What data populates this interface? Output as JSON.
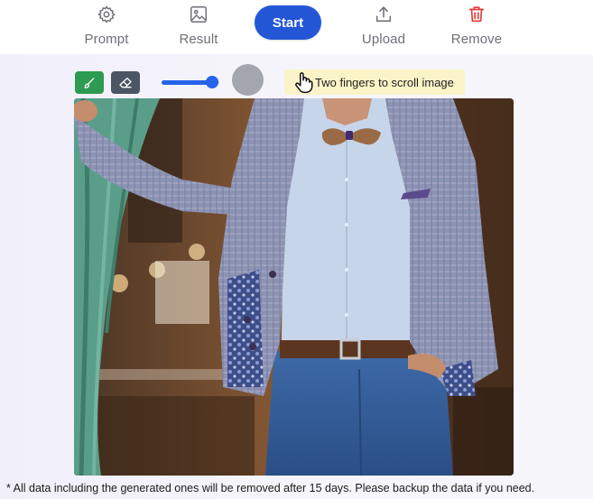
{
  "toolbar": {
    "prompt_label": "Prompt",
    "result_label": "Result",
    "start_label": "Start",
    "upload_label": "Upload",
    "remove_label": "Remove"
  },
  "controls": {
    "brush_size_fraction": 0.88,
    "brush_color": "#a3a6ae",
    "tooltip_text": "Two fingers to scroll image"
  },
  "colors": {
    "start_button": "#2457d6",
    "brush_button": "#2f9a52",
    "eraser_button": "#4b5563",
    "remove_icon": "#e23b3b",
    "slider": "#2563eb"
  },
  "footer": {
    "note": "* All data including the generated ones will be removed after 15 days. Please backup the data if you need."
  }
}
